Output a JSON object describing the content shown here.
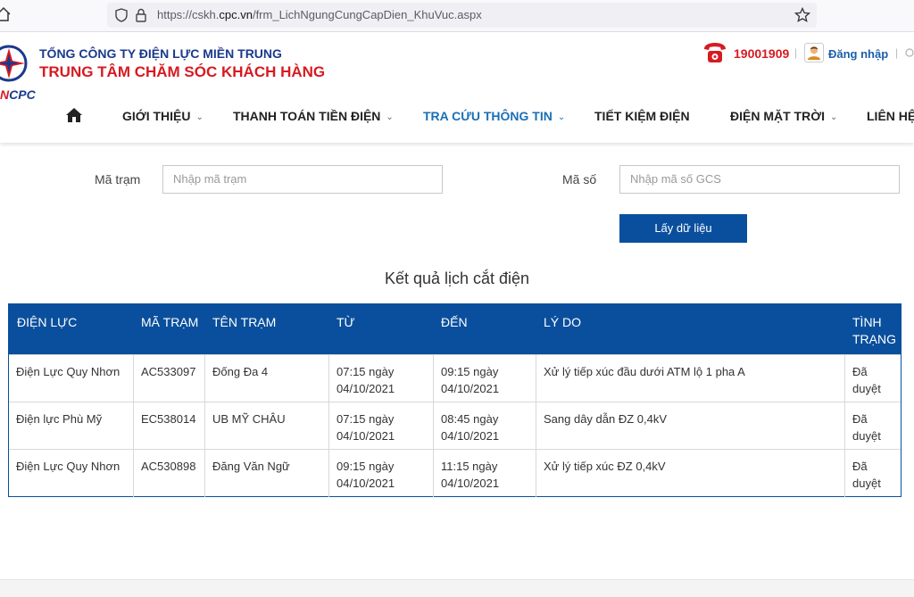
{
  "browser": {
    "url_prefix": "https://cskh.",
    "url_domain": "cpc.vn",
    "url_path": "/frm_LichNgungCungCapDien_KhuVuc.aspx"
  },
  "header": {
    "logo_text_red": "N",
    "logo_text_blue": "CPC",
    "company_name": "TỔNG CÔNG TY ĐIỆN LỰC MIỀN TRUNG",
    "center_name": "TRUNG TÂM CHĂM SÓC KHÁCH HÀNG",
    "hotline": "19001909",
    "separator": "|",
    "login_label": "Đăng nhập"
  },
  "nav": {
    "items": [
      {
        "label": "GIỚI THIỆU",
        "chevron": "⌄"
      },
      {
        "label": "THANH TOÁN TIỀN ĐIỆN",
        "chevron": "⌄"
      },
      {
        "label": "TRA CỨU THÔNG TIN",
        "chevron": "⌄"
      },
      {
        "label": "TIẾT KIỆM ĐIỆN",
        "chevron": ""
      },
      {
        "label": "ĐIỆN MẶT TRỜI",
        "chevron": "⌄"
      },
      {
        "label": "LIÊN HỆ",
        "chevron": ""
      }
    ]
  },
  "form": {
    "station_code_label": "Mã trạm",
    "station_code_placeholder": "Nhập mã trạm",
    "code_label": "Mã số",
    "code_placeholder": "Nhập mã số GCS",
    "submit_label": "Lấy dữ liệu"
  },
  "results": {
    "title": "Kết quả lịch cắt điện",
    "columns": [
      "ĐIỆN LỰC",
      "MÃ TRẠM",
      "TÊN TRẠM",
      "TỪ",
      "ĐẾN",
      "LÝ DO",
      "TÌNH",
      "TRẠNG"
    ],
    "rows": [
      {
        "dien_luc": "Điện Lực Quy Nhơn",
        "ma_tram": "AC533097",
        "ten_tram": "Đống Đa 4",
        "tu_1": "07:15 ngày",
        "tu_2": "04/10/2021",
        "den_1": "09:15 ngày",
        "den_2": "04/10/2021",
        "ly_do": "Xử lý tiếp xúc đầu dưới ATM lộ 1 pha A",
        "tt_1": "Đã",
        "tt_2": "duyệt"
      },
      {
        "dien_luc": "Điện lực Phù Mỹ",
        "ma_tram": "EC538014",
        "ten_tram": "UB MỸ CHÂU",
        "tu_1": "07:15 ngày",
        "tu_2": "04/10/2021",
        "den_1": "08:45 ngày",
        "den_2": "04/10/2021",
        "ly_do": "Sang dây dẫn ĐZ 0,4kV",
        "tt_1": "Đã",
        "tt_2": "duyệt"
      },
      {
        "dien_luc": "Điện Lực Quy Nhơn",
        "ma_tram": "AC530898",
        "ten_tram": "Đăng Văn Ngữ",
        "tu_1": "09:15 ngày",
        "tu_2": "04/10/2021",
        "den_1": "11:15 ngày",
        "den_2": "04/10/2021",
        "ly_do": "Xử lý tiếp xúc ĐZ 0,4kV",
        "tt_1": "Đã",
        "tt_2": "duyệt"
      }
    ]
  },
  "colors": {
    "primary": "#0a4f9d",
    "brand_red": "#d71a21",
    "brand_blue": "#1a3a8c",
    "nav_active": "#1a6fb5"
  },
  "icons": [
    "home-icon",
    "shield-icon",
    "lock-icon",
    "star-icon",
    "phone-icon",
    "user-icon",
    "search-icon",
    "nav-home-icon"
  ]
}
